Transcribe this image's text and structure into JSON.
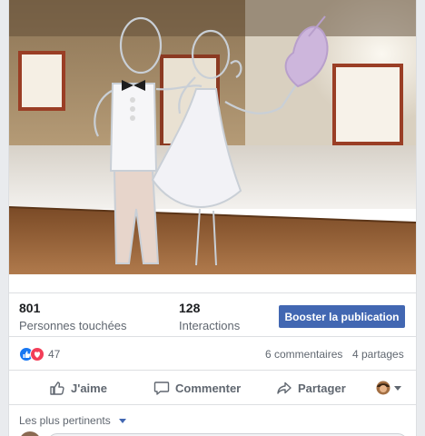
{
  "insights": {
    "reach_value": "801",
    "reach_label": "Personnes touchées",
    "engagement_value": "128",
    "engagement_label": "Interactions",
    "boost_label": "Booster la publication"
  },
  "reactions": {
    "count": "47",
    "comments": "6 commentaires",
    "shares": "4 partages",
    "like_color": "#1877f2",
    "love_color": "#f33e58"
  },
  "actions": {
    "like": "J'aime",
    "comment": "Commenter",
    "share": "Partager"
  },
  "comments": {
    "sort_label": "Les plus pertinents"
  },
  "colors": {
    "accent": "#4267b2",
    "secondary_text": "#606770",
    "divider": "#dddfe2"
  },
  "icons": [
    "like-icon",
    "love-icon",
    "thumbs-up-icon",
    "comment-icon",
    "share-icon",
    "caret-down-icon"
  ]
}
